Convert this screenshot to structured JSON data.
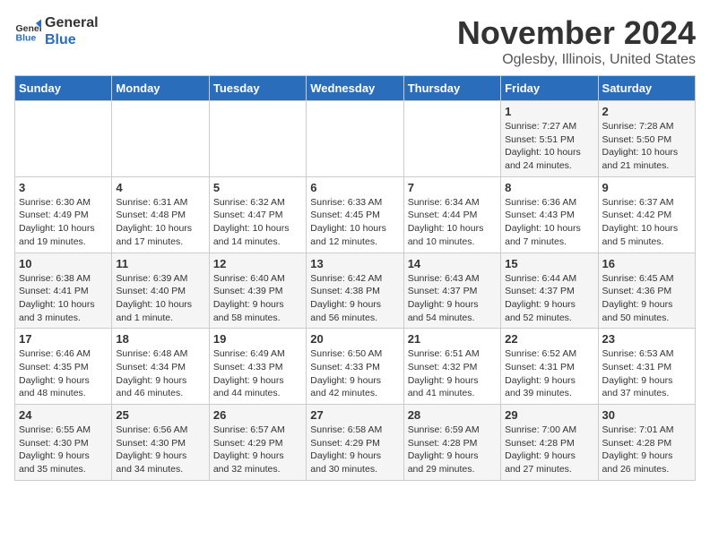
{
  "logo": {
    "general": "General",
    "blue": "Blue"
  },
  "title": "November 2024",
  "location": "Oglesby, Illinois, United States",
  "days_of_week": [
    "Sunday",
    "Monday",
    "Tuesday",
    "Wednesday",
    "Thursday",
    "Friday",
    "Saturday"
  ],
  "weeks": [
    [
      {
        "day": "",
        "info": ""
      },
      {
        "day": "",
        "info": ""
      },
      {
        "day": "",
        "info": ""
      },
      {
        "day": "",
        "info": ""
      },
      {
        "day": "",
        "info": ""
      },
      {
        "day": "1",
        "info": "Sunrise: 7:27 AM\nSunset: 5:51 PM\nDaylight: 10 hours\nand 24 minutes."
      },
      {
        "day": "2",
        "info": "Sunrise: 7:28 AM\nSunset: 5:50 PM\nDaylight: 10 hours\nand 21 minutes."
      }
    ],
    [
      {
        "day": "3",
        "info": "Sunrise: 6:30 AM\nSunset: 4:49 PM\nDaylight: 10 hours\nand 19 minutes."
      },
      {
        "day": "4",
        "info": "Sunrise: 6:31 AM\nSunset: 4:48 PM\nDaylight: 10 hours\nand 17 minutes."
      },
      {
        "day": "5",
        "info": "Sunrise: 6:32 AM\nSunset: 4:47 PM\nDaylight: 10 hours\nand 14 minutes."
      },
      {
        "day": "6",
        "info": "Sunrise: 6:33 AM\nSunset: 4:45 PM\nDaylight: 10 hours\nand 12 minutes."
      },
      {
        "day": "7",
        "info": "Sunrise: 6:34 AM\nSunset: 4:44 PM\nDaylight: 10 hours\nand 10 minutes."
      },
      {
        "day": "8",
        "info": "Sunrise: 6:36 AM\nSunset: 4:43 PM\nDaylight: 10 hours\nand 7 minutes."
      },
      {
        "day": "9",
        "info": "Sunrise: 6:37 AM\nSunset: 4:42 PM\nDaylight: 10 hours\nand 5 minutes."
      }
    ],
    [
      {
        "day": "10",
        "info": "Sunrise: 6:38 AM\nSunset: 4:41 PM\nDaylight: 10 hours\nand 3 minutes."
      },
      {
        "day": "11",
        "info": "Sunrise: 6:39 AM\nSunset: 4:40 PM\nDaylight: 10 hours\nand 1 minute."
      },
      {
        "day": "12",
        "info": "Sunrise: 6:40 AM\nSunset: 4:39 PM\nDaylight: 9 hours\nand 58 minutes."
      },
      {
        "day": "13",
        "info": "Sunrise: 6:42 AM\nSunset: 4:38 PM\nDaylight: 9 hours\nand 56 minutes."
      },
      {
        "day": "14",
        "info": "Sunrise: 6:43 AM\nSunset: 4:37 PM\nDaylight: 9 hours\nand 54 minutes."
      },
      {
        "day": "15",
        "info": "Sunrise: 6:44 AM\nSunset: 4:37 PM\nDaylight: 9 hours\nand 52 minutes."
      },
      {
        "day": "16",
        "info": "Sunrise: 6:45 AM\nSunset: 4:36 PM\nDaylight: 9 hours\nand 50 minutes."
      }
    ],
    [
      {
        "day": "17",
        "info": "Sunrise: 6:46 AM\nSunset: 4:35 PM\nDaylight: 9 hours\nand 48 minutes."
      },
      {
        "day": "18",
        "info": "Sunrise: 6:48 AM\nSunset: 4:34 PM\nDaylight: 9 hours\nand 46 minutes."
      },
      {
        "day": "19",
        "info": "Sunrise: 6:49 AM\nSunset: 4:33 PM\nDaylight: 9 hours\nand 44 minutes."
      },
      {
        "day": "20",
        "info": "Sunrise: 6:50 AM\nSunset: 4:33 PM\nDaylight: 9 hours\nand 42 minutes."
      },
      {
        "day": "21",
        "info": "Sunrise: 6:51 AM\nSunset: 4:32 PM\nDaylight: 9 hours\nand 41 minutes."
      },
      {
        "day": "22",
        "info": "Sunrise: 6:52 AM\nSunset: 4:31 PM\nDaylight: 9 hours\nand 39 minutes."
      },
      {
        "day": "23",
        "info": "Sunrise: 6:53 AM\nSunset: 4:31 PM\nDaylight: 9 hours\nand 37 minutes."
      }
    ],
    [
      {
        "day": "24",
        "info": "Sunrise: 6:55 AM\nSunset: 4:30 PM\nDaylight: 9 hours\nand 35 minutes."
      },
      {
        "day": "25",
        "info": "Sunrise: 6:56 AM\nSunset: 4:30 PM\nDaylight: 9 hours\nand 34 minutes."
      },
      {
        "day": "26",
        "info": "Sunrise: 6:57 AM\nSunset: 4:29 PM\nDaylight: 9 hours\nand 32 minutes."
      },
      {
        "day": "27",
        "info": "Sunrise: 6:58 AM\nSunset: 4:29 PM\nDaylight: 9 hours\nand 30 minutes."
      },
      {
        "day": "28",
        "info": "Sunrise: 6:59 AM\nSunset: 4:28 PM\nDaylight: 9 hours\nand 29 minutes."
      },
      {
        "day": "29",
        "info": "Sunrise: 7:00 AM\nSunset: 4:28 PM\nDaylight: 9 hours\nand 27 minutes."
      },
      {
        "day": "30",
        "info": "Sunrise: 7:01 AM\nSunset: 4:28 PM\nDaylight: 9 hours\nand 26 minutes."
      }
    ]
  ]
}
